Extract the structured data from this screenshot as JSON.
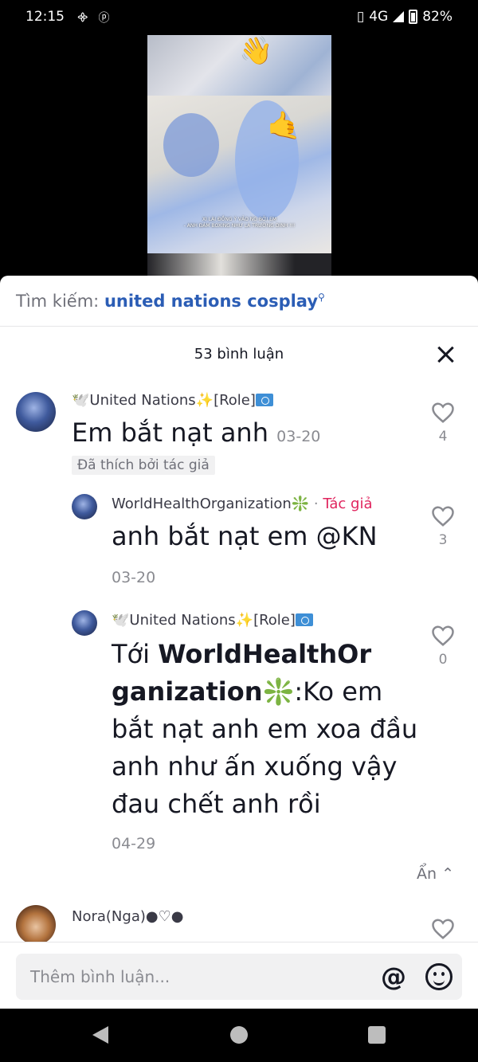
{
  "status_bar": {
    "time": "12:15",
    "network": "4G",
    "battery": "82%"
  },
  "video": {
    "caption_line1": "XI LÀI ĐỒNG Ý VẢO NG BỞI EM",
    "caption_line2": "- ANH ĐÁM BOXING NHƯ LÀ TRƯỜNG DINH !!!"
  },
  "search": {
    "prefix": "Tìm kiếm:",
    "term": "united nations cosplay"
  },
  "comments_panel": {
    "title": "53 bình luận",
    "hide_label": "Ẩn"
  },
  "comments": [
    {
      "username": "United Nations",
      "role": "[Role]",
      "text": "Em bắt nạt anh",
      "date": "03-20",
      "badge": "Đã thích bởi tác giả",
      "likes": "4"
    },
    {
      "username": "WorldHealthOrganization",
      "separator": "·",
      "author_tag": "Tác giả",
      "text": "anh bắt nạt em @KN",
      "date": "03-20",
      "likes": "3"
    },
    {
      "username": "United Nations",
      "role": "[Role]",
      "reply_prefix": "Tới",
      "reply_target": "WorldHealthOr ganization",
      "text": ":Ko em bắt nạt anh em xoa đầu anh như ấn xuống vậy đau chết anh rồi",
      "date": "04-29",
      "likes": "0"
    },
    {
      "username": "Nora(Nga)",
      "suffix": "●♡●"
    }
  ],
  "input": {
    "placeholder": "Thêm bình luận...",
    "at_symbol": "@"
  },
  "colors": {
    "search_term": "#2b5db5",
    "author_tag": "#e0245e",
    "text_primary": "#161823",
    "text_secondary": "#8a8b91"
  }
}
